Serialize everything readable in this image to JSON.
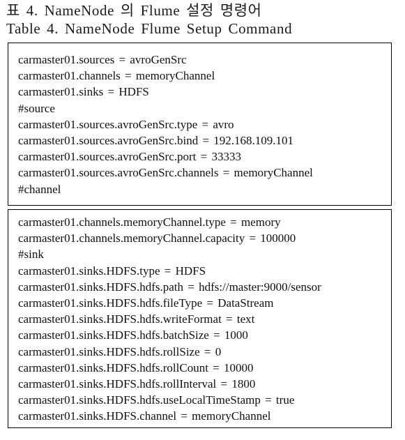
{
  "caption": {
    "korean": "표 4. NameNode 의 Flume 설정 명령어",
    "english": "Table 4. NameNode Flume Setup Command"
  },
  "blocks": [
    {
      "lines": [
        "carmaster01.sources = avroGenSrc",
        "carmaster01.channels = memoryChannel",
        "carmaster01.sinks = HDFS",
        "#source",
        "carmaster01.sources.avroGenSrc.type = avro",
        "carmaster01.sources.avroGenSrc.bind = 192.168.109.101",
        "carmaster01.sources.avroGenSrc.port = 33333",
        "carmaster01.sources.avroGenSrc.channels = memoryChannel",
        "#channel"
      ]
    },
    {
      "lines": [
        "carmaster01.channels.memoryChannel.type = memory",
        "carmaster01.channels.memoryChannel.capacity = 100000",
        "#sink",
        "carmaster01.sinks.HDFS.type = HDFS",
        "carmaster01.sinks.HDFS.hdfs.path = hdfs://master:9000/sensor",
        "carmaster01.sinks.HDFS.hdfs.fileType = DataStream",
        "carmaster01.sinks.HDFS.hdfs.writeFormat = text",
        "carmaster01.sinks.HDFS.hdfs.batchSize = 1000",
        "carmaster01.sinks.HDFS.hdfs.rollSize = 0",
        "carmaster01.sinks.HDFS.hdfs.rollCount = 10000",
        "carmaster01.sinks.HDFS.hdfs.rollInterval = 1800",
        "carmaster01.sinks.HDFS.hdfs.useLocalTimeStamp = true",
        "carmaster01.sinks.HDFS.channel = memoryChannel"
      ]
    }
  ]
}
